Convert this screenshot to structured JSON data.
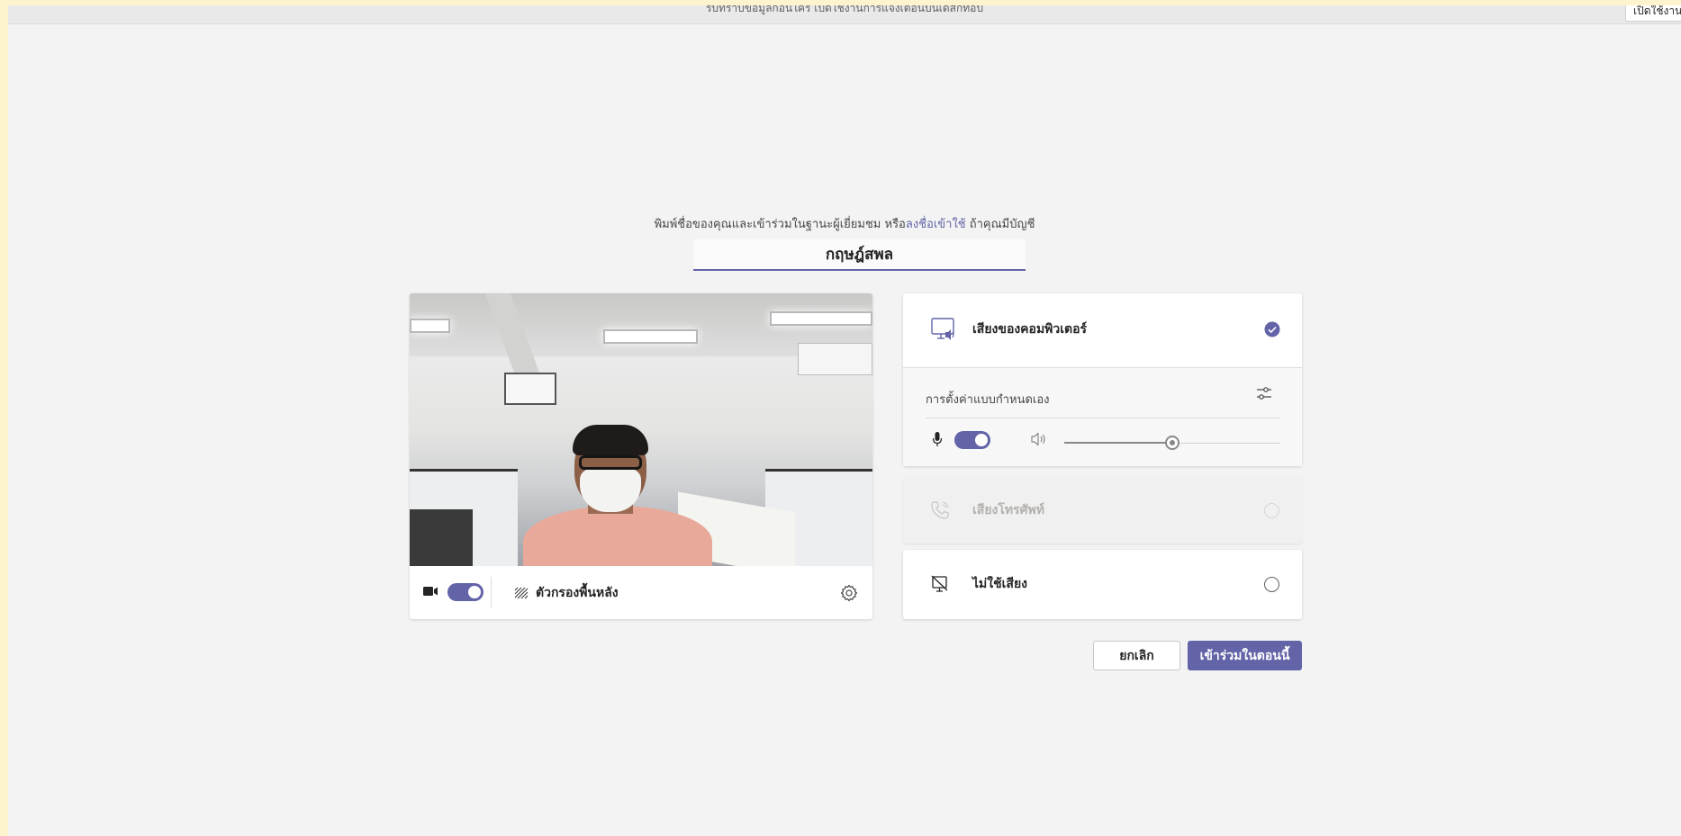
{
  "banner": {
    "text": "รับทราบข้อมูลก่อนใคร เปิดใช้งานการแจ้งเตือนบนเดสก์ท็อป",
    "button_label": "เปิดใช้งาน"
  },
  "join": {
    "prompt_before": "พิมพ์ชื่อของคุณและเข้าร่วมในฐานะผู้เยี่ยมชม หรือ",
    "prompt_link": "ลงชื่อเข้าใช้",
    "prompt_after": " ถ้าคุณมีบัญชี",
    "name_value": "กฤษฎ์สพล"
  },
  "video": {
    "camera_on": true,
    "background_filter_label": "ตัวกรองพื้นหลัง"
  },
  "audio": {
    "computer_audio_label": "เสียงของคอมพิวเตอร์",
    "custom_setup_label": "การตั้งค่าแบบกำหนดเอง",
    "mic_on": true,
    "speaker_volume": 0.5,
    "phone_audio_label": "เสียงโทรศัพท์",
    "no_audio_label": "ไม่ใช้เสียง"
  },
  "actions": {
    "cancel_label": "ยกเลิก",
    "join_label": "เข้าร่วมในตอนนี้"
  },
  "colors": {
    "accent": "#6264a7",
    "background": "#f3f3f3"
  }
}
